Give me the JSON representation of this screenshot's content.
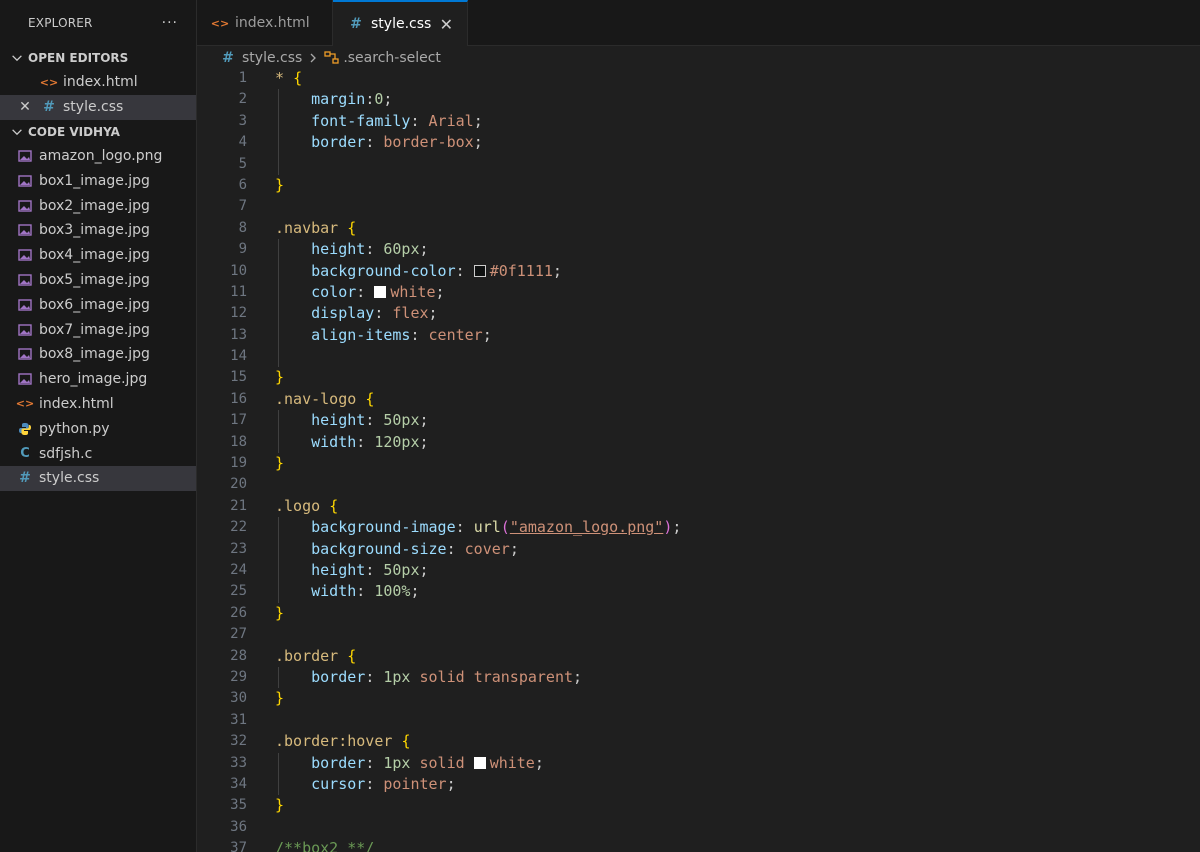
{
  "sidebar": {
    "title": "EXPLORER",
    "more": "···",
    "open_editors_label": "OPEN EDITORS",
    "open_editors": [
      {
        "name": "index.html",
        "type": "html-file-icon"
      },
      {
        "name": "style.css",
        "type": "css-file-icon",
        "close": "✕"
      }
    ],
    "project_label": "CODE VIDHYA",
    "files": [
      {
        "name": "amazon_logo.png"
      },
      {
        "name": "box1_image.jpg"
      },
      {
        "name": "box2_image.jpg"
      },
      {
        "name": "box3_image.jpg"
      },
      {
        "name": "box4_image.jpg"
      },
      {
        "name": "box5_image.jpg"
      },
      {
        "name": "box6_image.jpg"
      },
      {
        "name": "box7_image.jpg"
      },
      {
        "name": "box8_image.jpg"
      },
      {
        "name": "hero_image.jpg"
      },
      {
        "name": "index.html"
      },
      {
        "name": "python.py"
      },
      {
        "name": "sdfjsh.c"
      },
      {
        "name": "style.css"
      }
    ]
  },
  "tabs": [
    {
      "label": "index.html"
    },
    {
      "label": "style.css",
      "close": "✕"
    }
  ],
  "breadcrumb": {
    "file": "style.css",
    "symbol": ".search-select"
  },
  "colors": {
    "swatch_dark": "#0f1111",
    "swatch_white": "#ffffff",
    "accent": "#0078d4"
  },
  "lines": [
    {
      "n": "1",
      "t": "* {"
    },
    {
      "n": "2",
      "t": "margin:0;"
    },
    {
      "n": "3",
      "t": "font-family: Arial;"
    },
    {
      "n": "4",
      "t": "border: border-box;"
    },
    {
      "n": "5",
      "t": ""
    },
    {
      "n": "6",
      "t": "}"
    },
    {
      "n": "7",
      "t": ""
    },
    {
      "n": "8",
      "t": ".navbar {"
    },
    {
      "n": "9",
      "t": "height: 60px;"
    },
    {
      "n": "10",
      "t": "background-color: #0f1111;"
    },
    {
      "n": "11",
      "t": "color: white;"
    },
    {
      "n": "12",
      "t": "display: flex;"
    },
    {
      "n": "13",
      "t": "align-items: center;"
    },
    {
      "n": "14",
      "t": ""
    },
    {
      "n": "15",
      "t": "}"
    },
    {
      "n": "16",
      "t": ".nav-logo {"
    },
    {
      "n": "17",
      "t": "height: 50px;"
    },
    {
      "n": "18",
      "t": "width: 120px;"
    },
    {
      "n": "19",
      "t": "}"
    },
    {
      "n": "20",
      "t": ""
    },
    {
      "n": "21",
      "t": ".logo {"
    },
    {
      "n": "22",
      "t": "background-image: url(\"amazon_logo.png\");"
    },
    {
      "n": "23",
      "t": "background-size: cover;"
    },
    {
      "n": "24",
      "t": "height: 50px;"
    },
    {
      "n": "25",
      "t": "width: 100%;"
    },
    {
      "n": "26",
      "t": "}"
    },
    {
      "n": "27",
      "t": ""
    },
    {
      "n": "28",
      "t": ".border {"
    },
    {
      "n": "29",
      "t": "border: 1px solid transparent;"
    },
    {
      "n": "30",
      "t": "}"
    },
    {
      "n": "31",
      "t": ""
    },
    {
      "n": "32",
      "t": ".border:hover {"
    },
    {
      "n": "33",
      "t": "border: 1px solid white;"
    },
    {
      "n": "34",
      "t": "cursor: pointer;"
    },
    {
      "n": "35",
      "t": "}"
    },
    {
      "n": "36",
      "t": ""
    },
    {
      "n": "37",
      "t": "/**box2 **/"
    }
  ]
}
